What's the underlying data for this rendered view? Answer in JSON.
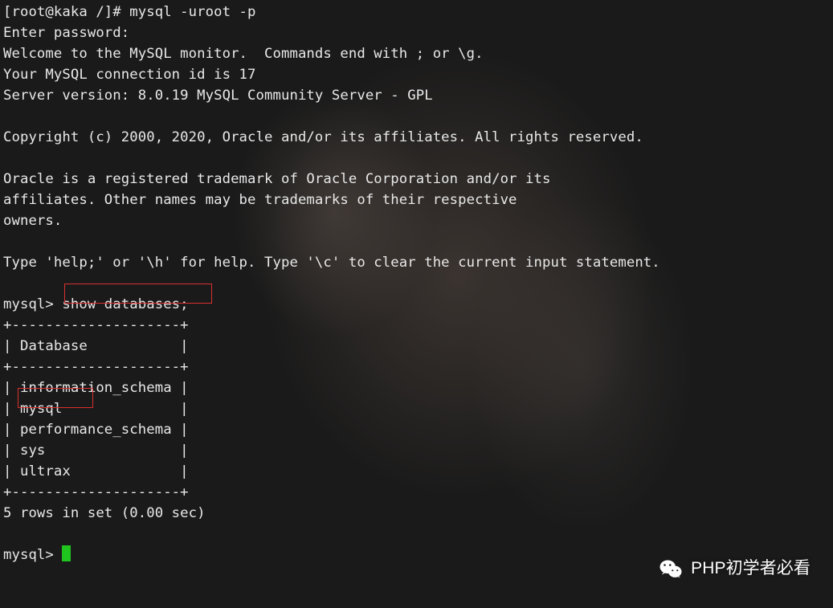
{
  "lines": [
    "[root@kaka /]# mysql -uroot -p",
    "Enter password:",
    "Welcome to the MySQL monitor.  Commands end with ; or \\g.",
    "Your MySQL connection id is 17",
    "Server version: 8.0.19 MySQL Community Server - GPL",
    "",
    "Copyright (c) 2000, 2020, Oracle and/or its affiliates. All rights reserved.",
    "",
    "Oracle is a registered trademark of Oracle Corporation and/or its",
    "affiliates. Other names may be trademarks of their respective",
    "owners.",
    "",
    "Type 'help;' or '\\h' for help. Type '\\c' to clear the current input statement.",
    "",
    "mysql> show databases;",
    "+--------------------+",
    "| Database           |",
    "+--------------------+",
    "| information_schema |",
    "| mysql              |",
    "| performance_schema |",
    "| sys                |",
    "| ultrax             |",
    "+--------------------+",
    "5 rows in set (0.00 sec)",
    "",
    "mysql> "
  ],
  "highlights": {
    "cmd": "show databases;",
    "db": "mysql"
  },
  "watermark": "PHP初学者必看"
}
